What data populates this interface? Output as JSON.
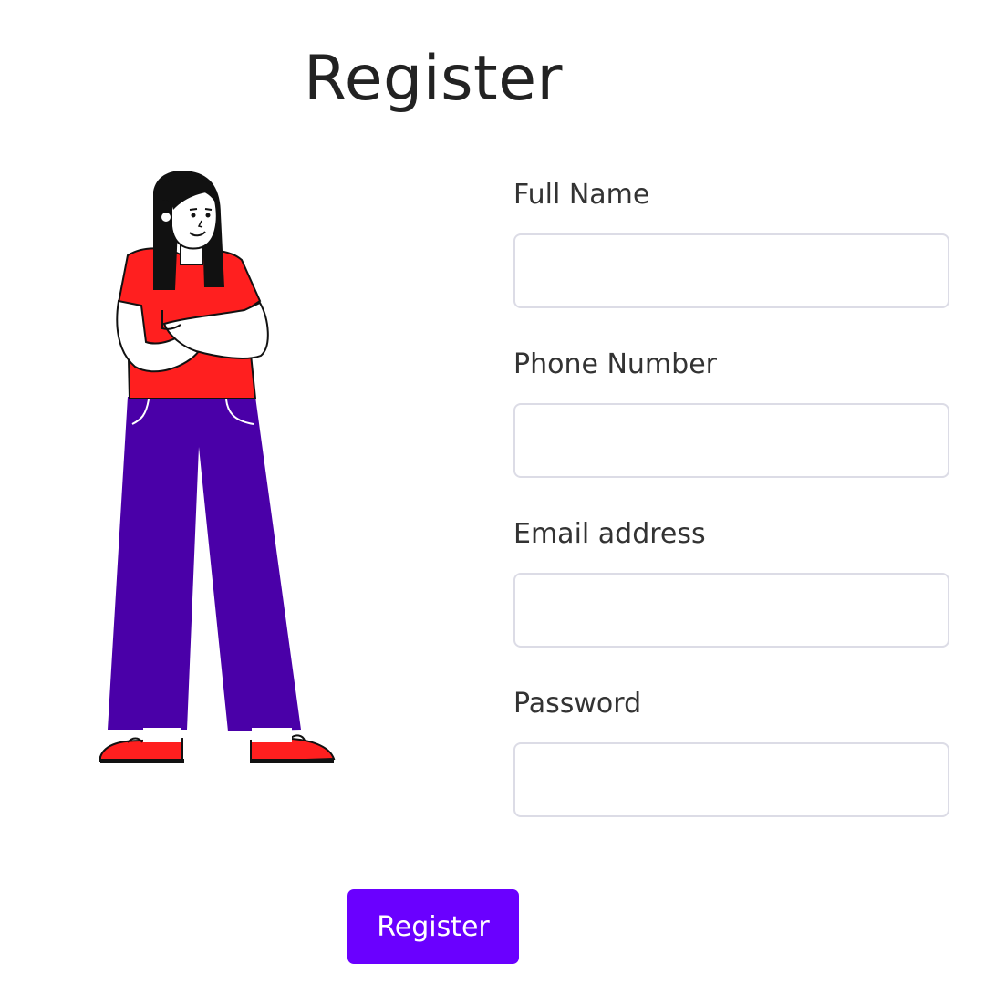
{
  "title": "Register",
  "fields": [
    {
      "label": "Full Name",
      "value": "",
      "placeholder": ""
    },
    {
      "label": "Phone Number",
      "value": "",
      "placeholder": ""
    },
    {
      "label": "Email address",
      "value": "",
      "placeholder": ""
    },
    {
      "label": "Password",
      "value": "",
      "placeholder": ""
    }
  ],
  "submit_label": "Register",
  "colors": {
    "accent": "#6a00ff",
    "shirt": "#ff1f1f",
    "pants": "#4a00a8",
    "hair": "#111111",
    "shoes": "#ff1f1f"
  },
  "illustration_icon": "standing-woman-illustration"
}
